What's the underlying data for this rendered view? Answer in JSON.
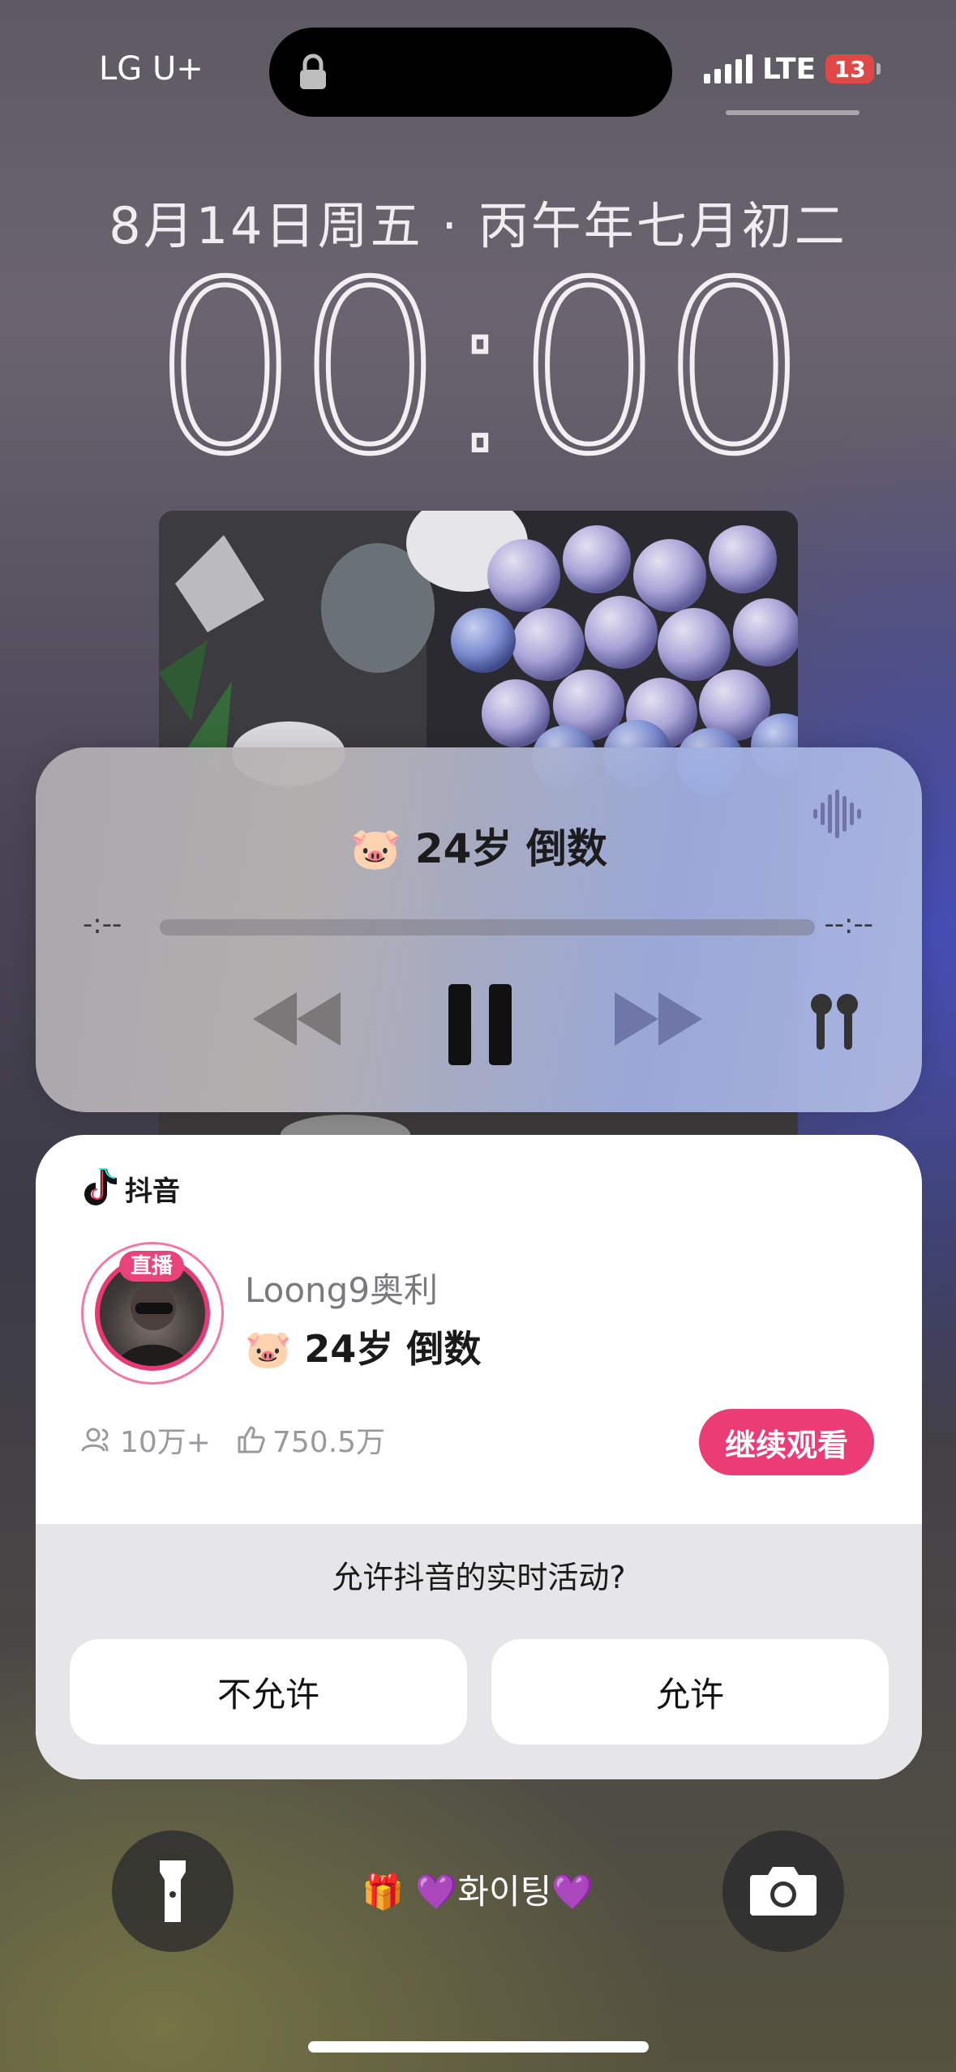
{
  "status_bar": {
    "carrier": "LG U+",
    "network": "LTE",
    "battery": "13"
  },
  "lock_screen": {
    "date": "8月14日周五 · 丙午年七月初二",
    "time": "00:00"
  },
  "now_playing": {
    "title": "🐷 24岁 倒数",
    "elapsed": "-:--",
    "remaining": "--:--",
    "progress": 0
  },
  "live_activity": {
    "app_name": "抖音",
    "live_badge": "直播",
    "streamer": "Loong9奥利",
    "stream_title": "🐷 24岁 倒数",
    "viewers": "10万+",
    "likes": "750.5万",
    "continue_label": "继续观看",
    "prompt": "允许抖音的实时活动?",
    "deny_label": "不允许",
    "allow_label": "允许",
    "accent_color": "#ec3c75"
  },
  "bottom": {
    "message": "🎁 💜화이팅💜"
  },
  "icons": [
    "lock-icon",
    "signal-icon",
    "battery-icon",
    "waveform-icon",
    "rewind-icon",
    "pause-icon",
    "forward-icon",
    "airpods-icon",
    "tiktok-icon",
    "viewers-icon",
    "likes-icon",
    "flashlight-icon",
    "camera-icon"
  ]
}
